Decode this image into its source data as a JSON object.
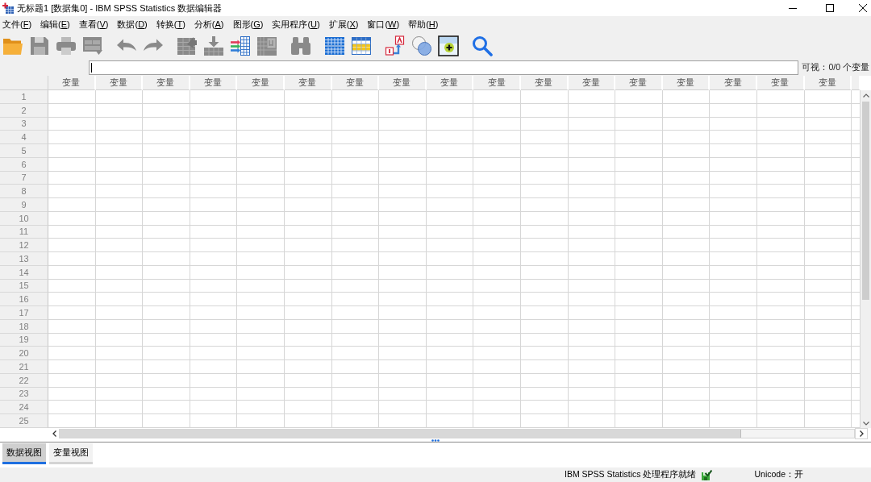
{
  "window": {
    "title": "无标题1 [数据集0] - IBM SPSS Statistics 数据编辑器"
  },
  "menu": [
    {
      "before": "文件(",
      "accel": "F",
      "after": ")"
    },
    {
      "before": "编辑(",
      "accel": "E",
      "after": ")"
    },
    {
      "before": "查看(",
      "accel": "V",
      "after": ")"
    },
    {
      "before": "数据(",
      "accel": "D",
      "after": ")"
    },
    {
      "before": "转换(",
      "accel": "T",
      "after": ")"
    },
    {
      "before": "分析(",
      "accel": "A",
      "after": ")"
    },
    {
      "before": "图形(",
      "accel": "G",
      "after": ")"
    },
    {
      "before": "实用程序(",
      "accel": "U",
      "after": ")"
    },
    {
      "before": "扩展(",
      "accel": "X",
      "after": ")"
    },
    {
      "before": "窗口(",
      "accel": "W",
      "after": ")"
    },
    {
      "before": "帮助(",
      "accel": "H",
      "after": ")"
    }
  ],
  "toolbar": [
    [
      {
        "kind": "open",
        "disabled": false
      },
      {
        "kind": "save",
        "disabled": true
      },
      {
        "kind": "print",
        "disabled": true
      },
      {
        "kind": "recall",
        "disabled": true
      }
    ],
    [
      {
        "kind": "undo",
        "disabled": true
      },
      {
        "kind": "redo",
        "disabled": true
      }
    ],
    [
      {
        "kind": "goto_case",
        "disabled": true
      },
      {
        "kind": "goto_variable",
        "disabled": true
      },
      {
        "kind": "variables",
        "disabled": false
      },
      {
        "kind": "attributes",
        "disabled": true
      }
    ],
    [
      {
        "kind": "find",
        "disabled": true
      }
    ],
    [
      {
        "kind": "insert_cases",
        "disabled": false
      },
      {
        "kind": "insert_variable",
        "disabled": false
      }
    ],
    [
      {
        "kind": "split_file",
        "disabled": false
      },
      {
        "kind": "weight_cases",
        "disabled": false
      },
      {
        "kind": "select_cases",
        "disabled": false
      }
    ],
    [
      {
        "kind": "search",
        "disabled": false
      }
    ]
  ],
  "visible_count": "可视：0/0 个变量",
  "columns": [
    "变量",
    "变量",
    "变量",
    "变量",
    "变量",
    "变量",
    "变量",
    "变量",
    "变量",
    "变量",
    "变量",
    "变量",
    "变量",
    "变量",
    "变量",
    "变量",
    "变量"
  ],
  "rows": [
    "1",
    "2",
    "3",
    "4",
    "5",
    "6",
    "7",
    "8",
    "9",
    "10",
    "11",
    "12",
    "13",
    "14",
    "15",
    "16",
    "17",
    "18",
    "19",
    "20",
    "21",
    "22",
    "23",
    "24",
    "25"
  ],
  "view_tabs": [
    {
      "label": "数据视图",
      "selected": true
    },
    {
      "label": "变量视图",
      "selected": false
    }
  ],
  "status_bar": {
    "message": "IBM SPSS Statistics 处理程序就绪",
    "encoding": "Unicode：开"
  }
}
